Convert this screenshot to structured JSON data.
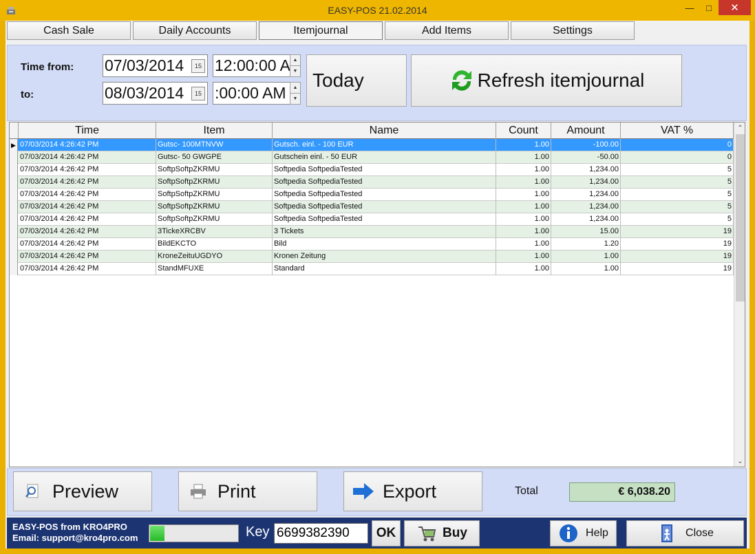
{
  "window": {
    "title": "EASY-POS 21.02.2014"
  },
  "tabs": [
    {
      "label": "Cash Sale"
    },
    {
      "label": "Daily Accounts"
    },
    {
      "label": "Itemjournal"
    },
    {
      "label": "Add Items"
    },
    {
      "label": "Settings"
    }
  ],
  "filter": {
    "time_from_label": "Time from:",
    "to_label": "to:",
    "date_from": "07/03/2014",
    "time_from": "12:00:00 A",
    "date_to": "08/03/2014",
    "time_to": ":00:00 AM",
    "calendar_glyph": "15",
    "today_label": "Today",
    "refresh_label": "Refresh itemjournal"
  },
  "grid": {
    "columns": [
      "Time",
      "Item",
      "Name",
      "Count",
      "Amount",
      "VAT %"
    ],
    "rows": [
      [
        "07/03/2014 4:26:42 PM",
        "Gutsc- 100MTNVW",
        "Gutsch. einl. - 100 EUR",
        "1.00",
        "-100.00",
        "0"
      ],
      [
        "07/03/2014 4:26:42 PM",
        "Gutsc- 50 GWGPE",
        "Gutschein einl. - 50 EUR",
        "1.00",
        "-50.00",
        "0"
      ],
      [
        "07/03/2014 4:26:42 PM",
        "SoftpSoftpZKRMU",
        "Softpedia SoftpediaTested",
        "1.00",
        "1,234.00",
        "5"
      ],
      [
        "07/03/2014 4:26:42 PM",
        "SoftpSoftpZKRMU",
        "Softpedia SoftpediaTested",
        "1.00",
        "1,234.00",
        "5"
      ],
      [
        "07/03/2014 4:26:42 PM",
        "SoftpSoftpZKRMU",
        "Softpedia SoftpediaTested",
        "1.00",
        "1,234.00",
        "5"
      ],
      [
        "07/03/2014 4:26:42 PM",
        "SoftpSoftpZKRMU",
        "Softpedia SoftpediaTested",
        "1.00",
        "1,234.00",
        "5"
      ],
      [
        "07/03/2014 4:26:42 PM",
        "SoftpSoftpZKRMU",
        "Softpedia SoftpediaTested",
        "1.00",
        "1,234.00",
        "5"
      ],
      [
        "07/03/2014 4:26:42 PM",
        "3TickeXRCBV",
        "3 Tickets",
        "1.00",
        "15.00",
        "19"
      ],
      [
        "07/03/2014 4:26:42 PM",
        "BildEKCTO",
        "Bild",
        "1.00",
        "1.20",
        "19"
      ],
      [
        "07/03/2014 4:26:42 PM",
        "KroneZeituUGDYO",
        "Kronen Zeitung",
        "1.00",
        "1.00",
        "19"
      ],
      [
        "07/03/2014 4:26:42 PM",
        "StandMFUXE",
        "Standard",
        "1.00",
        "1.00",
        "19"
      ]
    ]
  },
  "actions": {
    "preview_label": "Preview",
    "print_label": "Print",
    "export_label": "Export",
    "total_label": "Total",
    "total_value": "€ 6,038.20"
  },
  "footer": {
    "brand_line": "EASY-POS from KRO4PRO",
    "email_line": "Email: support@kro4pro.com",
    "progress": 0.16,
    "key_label": "Key",
    "key_value": "6699382390",
    "ok_label": "OK",
    "buy_label": "Buy",
    "help_label": "Help",
    "close_label": "Close"
  },
  "colors": {
    "frame": "#eab000",
    "panel": "#d3dcf6",
    "selection": "#3399ff",
    "alt_row": "#e6f1e6",
    "footer": "#1c3472",
    "total_bg": "#c6e0c4"
  }
}
